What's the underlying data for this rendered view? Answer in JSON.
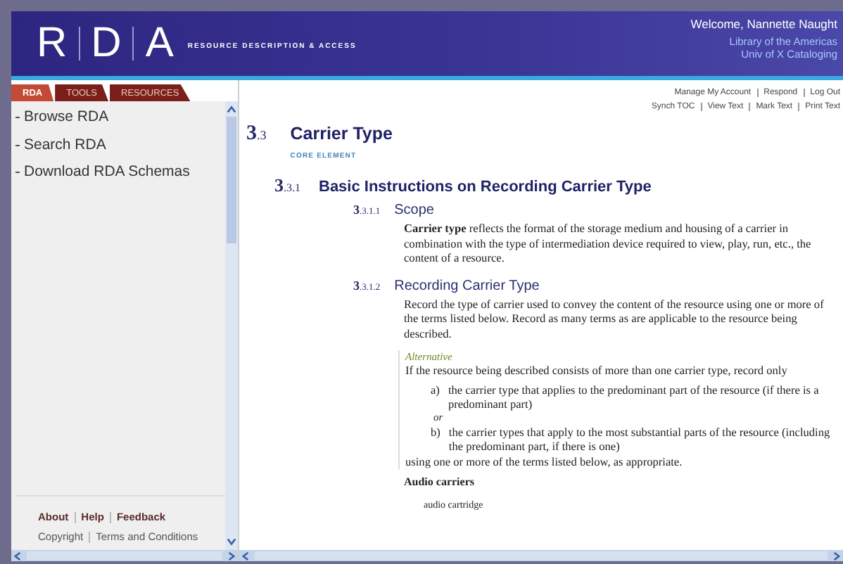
{
  "header": {
    "logo_letters": [
      "R",
      "D",
      "A"
    ],
    "tagline": "RESOURCE DESCRIPTION & ACCESS",
    "welcome": "Welcome, Nannette Naught",
    "org_lines": [
      "Library of the Americas",
      "Univ of X Cataloging"
    ]
  },
  "tabs": [
    {
      "label": "RDA",
      "selected": true
    },
    {
      "label": "TOOLS",
      "selected": false
    },
    {
      "label": "RESOURCES",
      "selected": false
    }
  ],
  "account_links": [
    "Manage My Account",
    "Respond",
    "Log Out"
  ],
  "view_links": [
    "Synch TOC",
    "View Text",
    "Mark Text",
    "Print Text"
  ],
  "sidebar": {
    "items": [
      "Browse RDA",
      "Search RDA",
      "Download RDA Schemas"
    ],
    "footer_links": [
      "About",
      "Help",
      "Feedback"
    ],
    "legal_links": [
      "Copyright",
      "Terms and Conditions"
    ]
  },
  "content": {
    "section": {
      "major": "3",
      "minor": ".3",
      "title": "Carrier Type",
      "badge": "CORE ELEMENT"
    },
    "subsection": {
      "major": "3",
      "minor": ".3.1",
      "title": "Basic Instructions on Recording Carrier Type"
    },
    "scope": {
      "major": "3",
      "minor": ".3.1.1",
      "title": "Scope",
      "text": "**Carrier type** reflects the format of the storage medium and housing of a carrier in combination with the type of intermediation device required to view, play, run, etc., the content of a resource."
    },
    "recording": {
      "major": "3",
      "minor": ".3.1.2",
      "title": "Recording Carrier Type",
      "text": "Record the type of carrier used to convey the content of the resource using one or more of the terms listed below. Record as many terms as are applicable to the resource being described.",
      "alternative": {
        "label": "Alternative",
        "intro": "If the resource being described consists of more than one carrier type, record only",
        "options": [
          {
            "mark": "a)",
            "text": "the carrier type that applies to the predominant part of the resource (if there is a predominant part)"
          },
          {
            "mark": "b)",
            "text": "the carrier types that apply to the most substantial parts of the resource (including the predominant part, if there is one)"
          }
        ],
        "connector": "or",
        "outro": "using one or more of the terms listed below, as appropriate."
      },
      "group_heading": "Audio carriers",
      "terms": [
        "audio cartridge"
      ]
    }
  }
}
